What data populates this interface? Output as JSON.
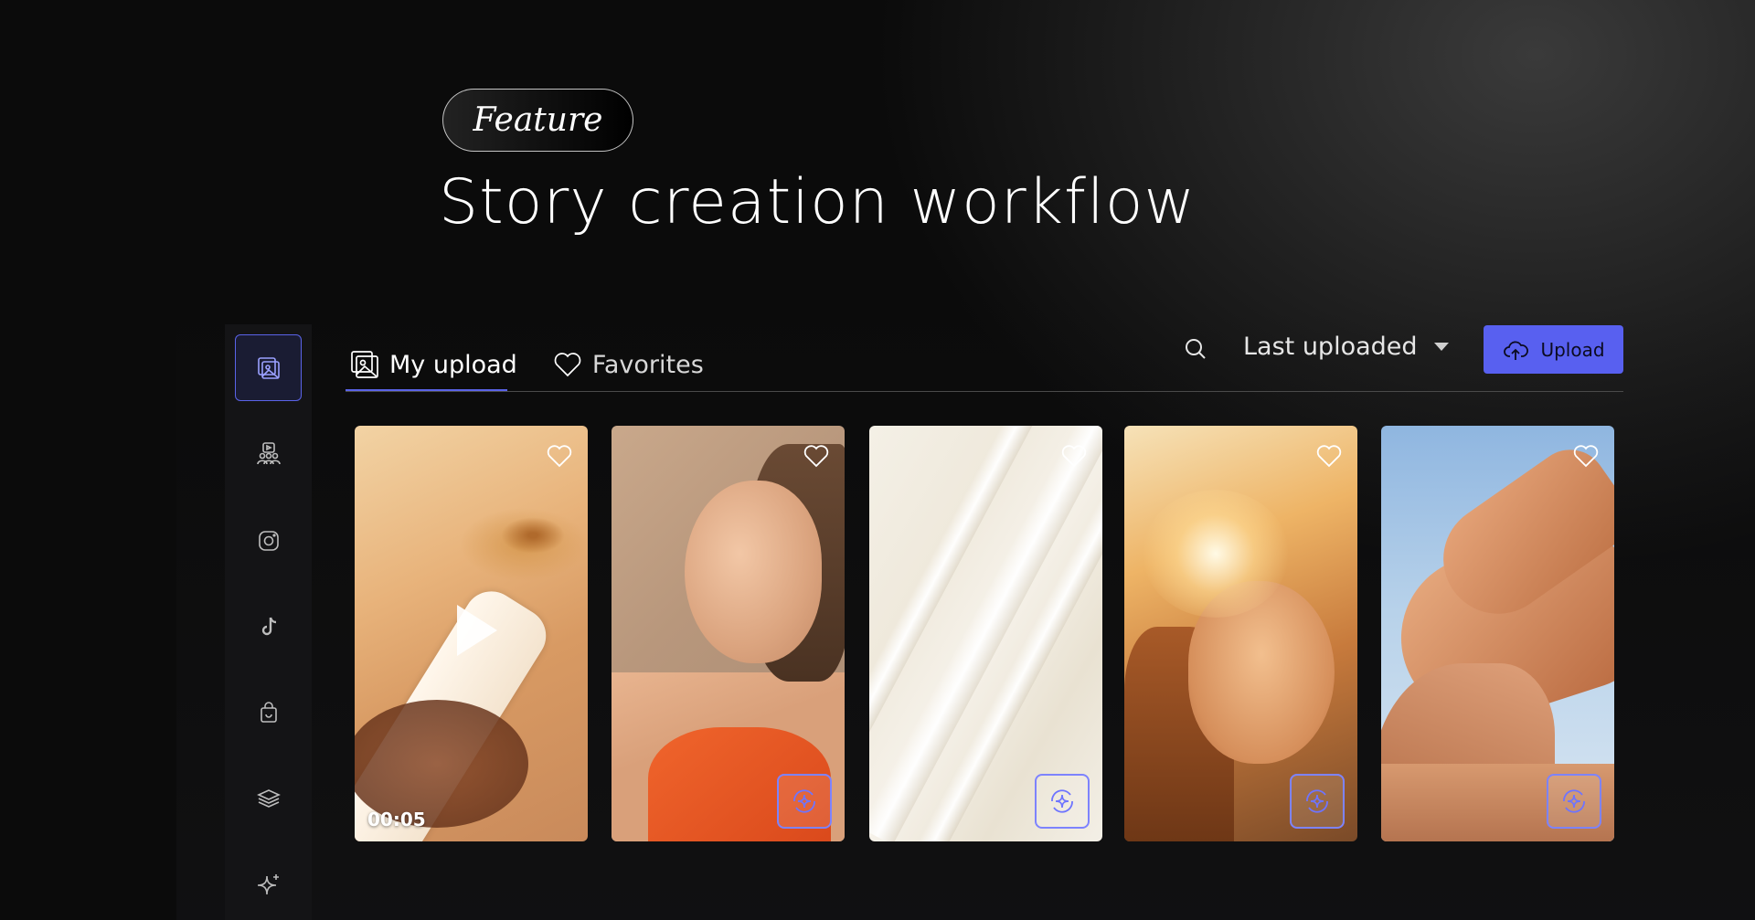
{
  "hero": {
    "pill": "Feature",
    "title": "Story creation workflow"
  },
  "sidebar": {
    "items": [
      {
        "name": "media-library-icon",
        "active": true
      },
      {
        "name": "creators-icon",
        "active": false
      },
      {
        "name": "instagram-icon",
        "active": false
      },
      {
        "name": "tiktok-icon",
        "active": false
      },
      {
        "name": "shopping-bag-icon",
        "active": false
      },
      {
        "name": "layers-icon",
        "active": false
      },
      {
        "name": "sparkles-icon",
        "active": false
      }
    ]
  },
  "tabs": [
    {
      "label": "My upload",
      "icon": "images-icon",
      "active": true
    },
    {
      "label": "Favorites",
      "icon": "heart-icon",
      "active": false
    }
  ],
  "toolbar": {
    "search_icon": "search-icon",
    "sort_label": "Last uploaded",
    "upload_label": "Upload",
    "upload_icon": "cloud-upload-icon"
  },
  "colors": {
    "accent": "#5860f0",
    "background": "#0b0b0b",
    "sidebar": "#141416"
  },
  "cards": [
    {
      "type": "video",
      "duration": "00:05",
      "favorite": false
    },
    {
      "type": "image",
      "favorite": false,
      "ai_action": true
    },
    {
      "type": "image",
      "favorite": false,
      "ai_action": true
    },
    {
      "type": "image",
      "favorite": false,
      "ai_action": true
    },
    {
      "type": "image",
      "favorite": false,
      "ai_action": true
    }
  ]
}
